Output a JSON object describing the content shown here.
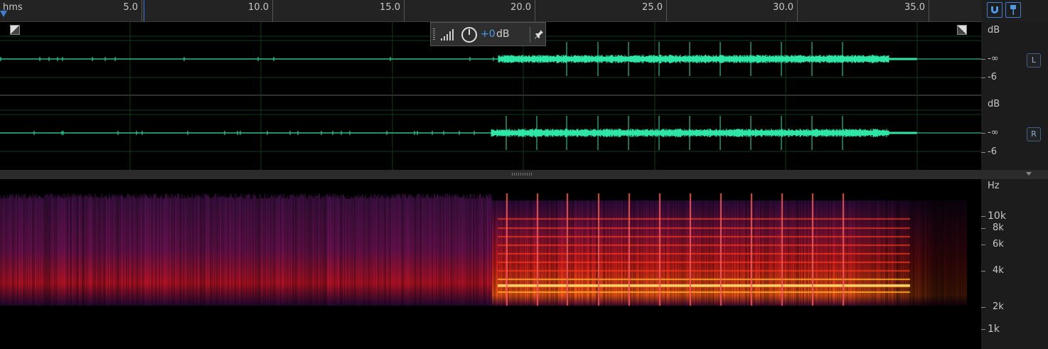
{
  "ruler": {
    "units_label": "hms",
    "labels": [
      "5.0",
      "10.0",
      "15.0",
      "20.0",
      "25.0",
      "30.0",
      "35.0"
    ]
  },
  "hud": {
    "volume_value": "+0",
    "volume_unit": "dB"
  },
  "channels": [
    {
      "name": "L",
      "db_label": "dB",
      "inf_label": "-∞",
      "minus6_label": "-6"
    },
    {
      "name": "R",
      "db_label": "dB",
      "inf_label": "-∞",
      "minus6_label": "-6"
    }
  ],
  "spectral": {
    "unit_label": "Hz",
    "freq_labels": [
      "10k",
      "8k",
      "6k",
      "4k",
      "2k",
      "1k"
    ]
  },
  "colors": {
    "waveform": "#2ee6a6",
    "accent": "#3d7fd6",
    "grid": "#0f3a1c"
  },
  "icons": [
    "snap-magnet-icon",
    "marker-pin-icon",
    "volume-level-icon",
    "volume-knob-icon",
    "pin-icon"
  ]
}
